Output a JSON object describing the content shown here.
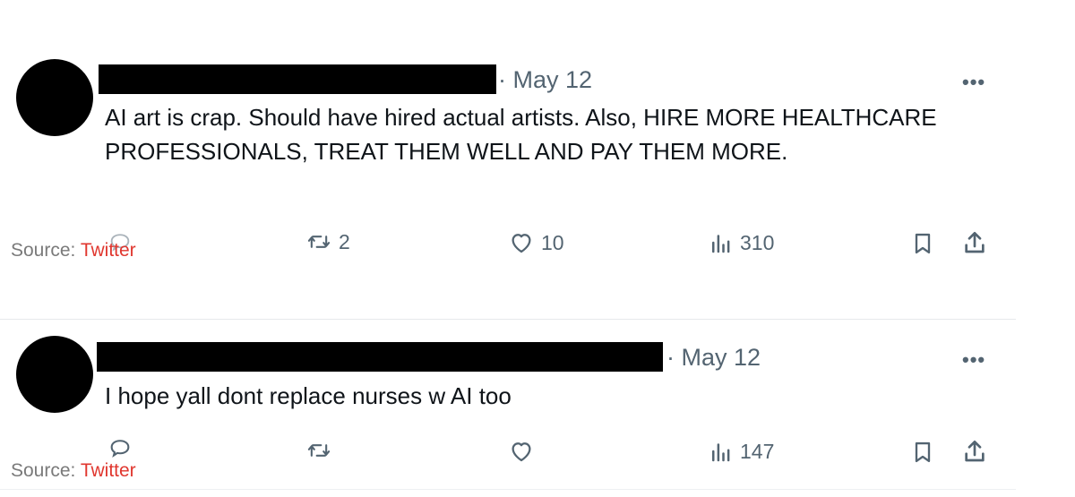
{
  "tweets": [
    {
      "date": "· May 12",
      "more_label": "•••",
      "text": "AI art is crap. Should have hired actual artists. Also, HIRE MORE HEALTHCARE PROFESSIONALS, TREAT THEM WELL AND PAY THEM MORE.",
      "replies": "",
      "retweets": "2",
      "likes": "10",
      "views": "310",
      "source_label": "Source: ",
      "source_link": "Twitter"
    },
    {
      "date": "· May 12",
      "more_label": "•••",
      "text": "I hope yall dont replace nurses w AI too",
      "replies": "",
      "retweets": "",
      "likes": "",
      "views": "147",
      "source_label": "Source: ",
      "source_link": "Twitter"
    }
  ],
  "icons": {
    "reply": "reply-icon",
    "retweet": "retweet-icon",
    "like": "heart-icon",
    "views": "views-icon",
    "bookmark": "bookmark-icon",
    "share": "share-icon"
  },
  "colors": {
    "text": "#0f1419",
    "secondary": "#536471",
    "source_link": "#e0372f",
    "redaction": "#000000"
  }
}
